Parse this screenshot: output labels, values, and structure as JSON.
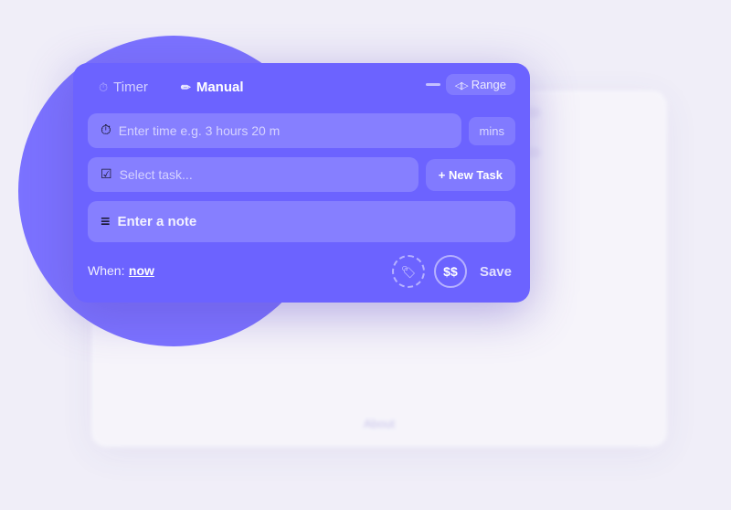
{
  "tabs": [
    {
      "id": "timer",
      "label": "Timer",
      "active": false
    },
    {
      "id": "manual",
      "label": "Manual",
      "active": true
    }
  ],
  "range_button": "Range",
  "time_input": {
    "placeholder": "Enter time e.g. 3 hours 20 m"
  },
  "mins_label": "mins",
  "task_input": {
    "placeholder": "Select task..."
  },
  "new_task_label": "+ New Task",
  "note_input": {
    "placeholder": "Enter a note"
  },
  "when": {
    "label": "When:",
    "value": "now"
  },
  "save_label": "Save",
  "about_label": "About",
  "icon_dollar": "$",
  "minimize_label": "—"
}
